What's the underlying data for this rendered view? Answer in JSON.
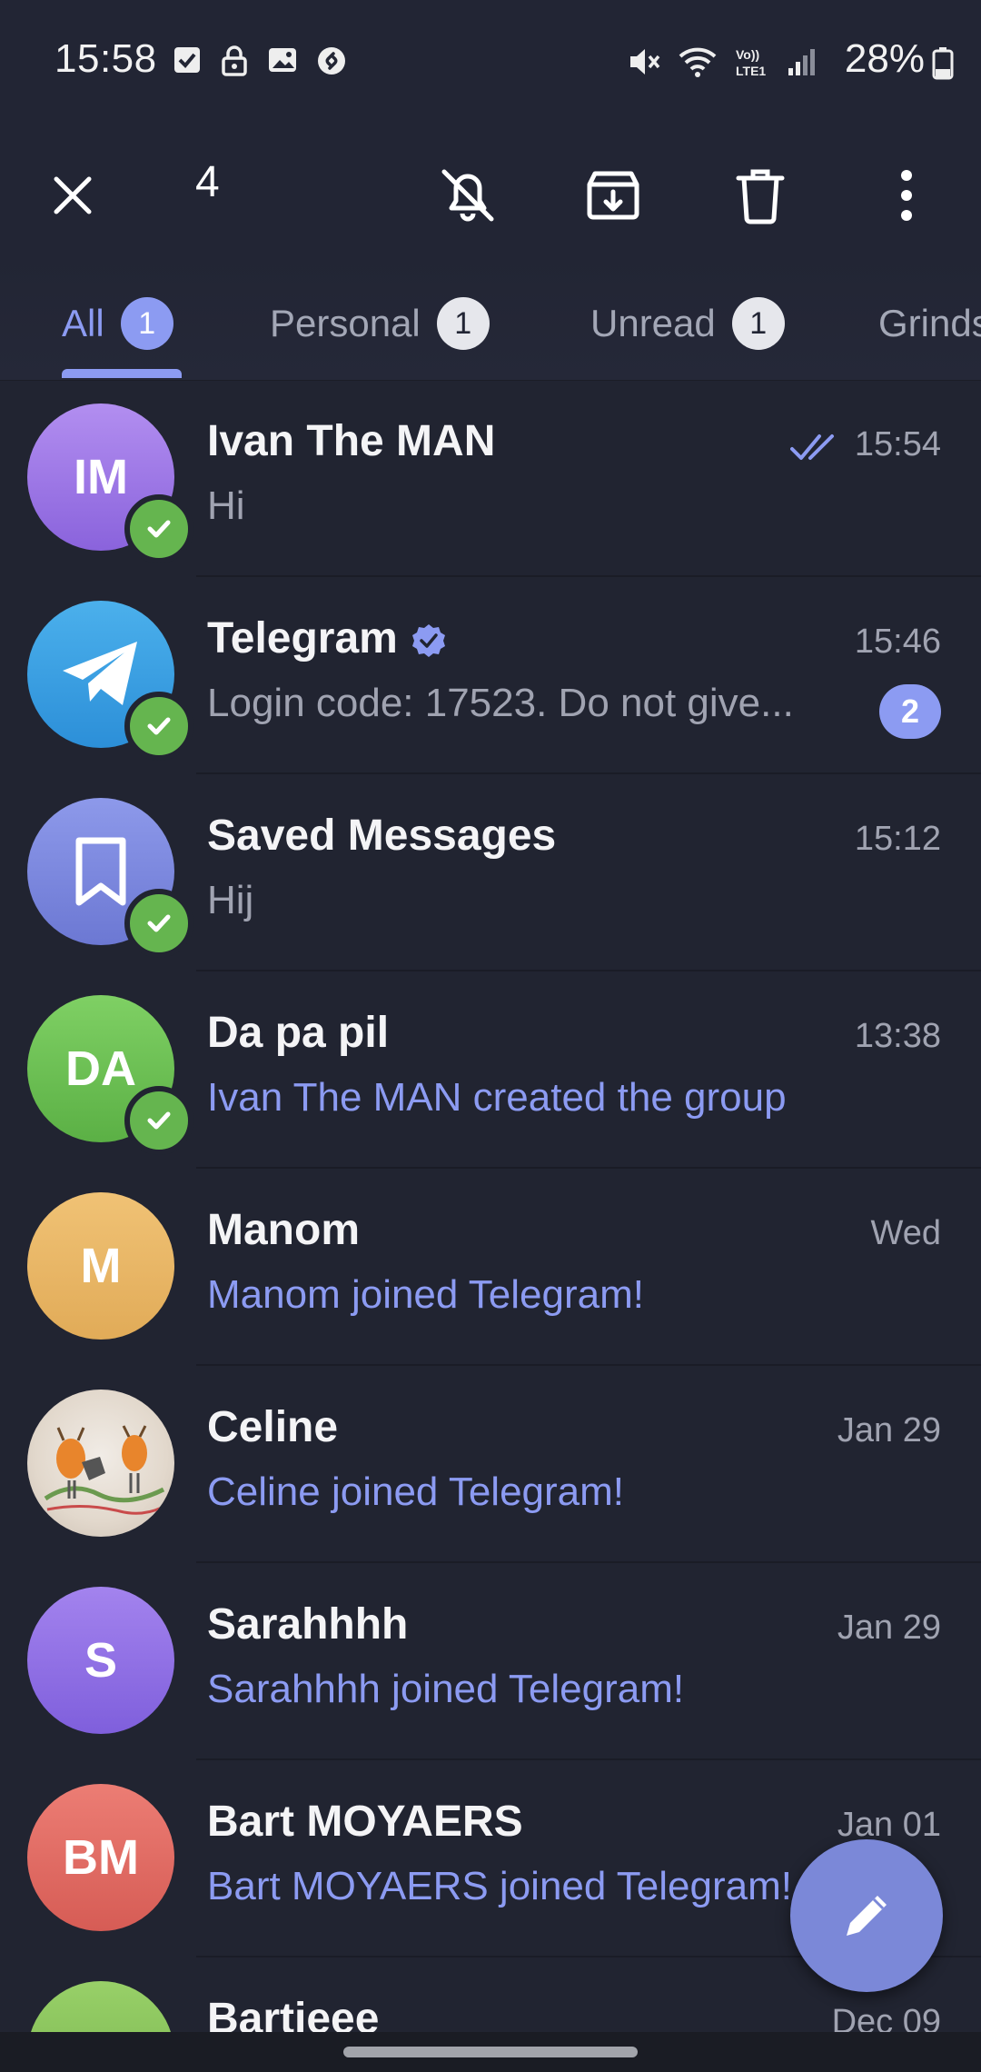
{
  "status_bar": {
    "time": "15:58",
    "battery": "28%",
    "network_label": "VoLTE1"
  },
  "toolbar": {
    "selected_count": "4",
    "icons": [
      "close-icon",
      "mute-icon",
      "archive-icon",
      "delete-icon",
      "more-icon"
    ]
  },
  "tabs": [
    {
      "label": "All",
      "badge": "1",
      "active": true
    },
    {
      "label": "Personal",
      "badge": "1",
      "active": false
    },
    {
      "label": "Unread",
      "badge": "1",
      "active": false
    },
    {
      "label": "Grinds",
      "badge": "",
      "active": false
    }
  ],
  "chats": [
    {
      "initials": "IM",
      "name": "Ivan The MAN",
      "preview": "Hi",
      "time": "15:54",
      "read_ticks": true,
      "selected": true
    },
    {
      "initials": "",
      "name": "Telegram",
      "preview": "Login code: 17523. Do not give...",
      "time": "15:46",
      "unread": "2",
      "verified": true,
      "selected": true
    },
    {
      "initials": "",
      "name": "Saved Messages",
      "preview": "Hij",
      "time": "15:12",
      "selected": true
    },
    {
      "initials": "DA",
      "name": "Da pa pil",
      "preview": "Ivan The MAN created the group",
      "time": "13:38",
      "selected": true
    },
    {
      "initials": "M",
      "name": "Manom",
      "preview": "Manom joined Telegram!",
      "time": "Wed",
      "selected": false
    },
    {
      "initials": "",
      "name": "Celine",
      "preview": "Celine joined Telegram!",
      "time": "Jan 29",
      "selected": false
    },
    {
      "initials": "S",
      "name": "Sarahhhh",
      "preview": "Sarahhhh joined Telegram!",
      "time": "Jan 29",
      "selected": false
    },
    {
      "initials": "BM",
      "name": "Bart MOYAERS",
      "preview": "Bart MOYAERS joined Telegram!",
      "time": "Jan 01",
      "selected": false
    },
    {
      "initials": "",
      "name": "Bartieee",
      "preview": "",
      "time": "Dec 09",
      "selected": false
    }
  ],
  "colors": {
    "background": "#212431",
    "header": "#222534",
    "accent": "#8c9bf2",
    "check_green": "#65b54f",
    "avatar_ivan": "#9e7be4",
    "avatar_telegram": "#3b9ee0",
    "avatar_saved": "#7b88d8",
    "avatar_dapapil": "#6cc056",
    "avatar_manom": "#e8b865",
    "avatar_sarah": "#9070e3",
    "avatar_bart": "#e06b64",
    "avatar_bartieee": "#8cc45c"
  }
}
